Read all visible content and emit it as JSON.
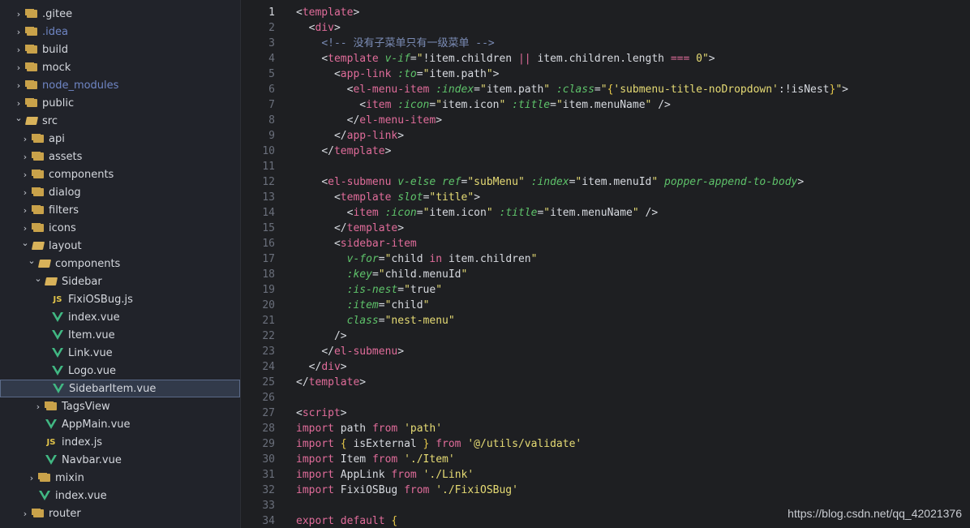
{
  "explorer": {
    "items": [
      {
        "label": ".gitee",
        "type": "folder",
        "expanded": false,
        "depth": 0
      },
      {
        "label": ".idea",
        "type": "folder",
        "expanded": false,
        "depth": 0,
        "dim": true
      },
      {
        "label": "build",
        "type": "folder",
        "expanded": false,
        "depth": 0
      },
      {
        "label": "mock",
        "type": "folder",
        "expanded": false,
        "depth": 0
      },
      {
        "label": "node_modules",
        "type": "folder",
        "expanded": false,
        "depth": 0,
        "dim": true
      },
      {
        "label": "public",
        "type": "folder",
        "expanded": false,
        "depth": 0
      },
      {
        "label": "src",
        "type": "folder",
        "expanded": true,
        "depth": 0
      },
      {
        "label": "api",
        "type": "folder",
        "expanded": false,
        "depth": 1
      },
      {
        "label": "assets",
        "type": "folder",
        "expanded": false,
        "depth": 1
      },
      {
        "label": "components",
        "type": "folder",
        "expanded": false,
        "depth": 1
      },
      {
        "label": "dialog",
        "type": "folder",
        "expanded": false,
        "depth": 1
      },
      {
        "label": "filters",
        "type": "folder",
        "expanded": false,
        "depth": 1
      },
      {
        "label": "icons",
        "type": "folder",
        "expanded": false,
        "depth": 1
      },
      {
        "label": "layout",
        "type": "folder",
        "expanded": true,
        "depth": 1
      },
      {
        "label": "components",
        "type": "folder",
        "expanded": true,
        "depth": 2
      },
      {
        "label": "Sidebar",
        "type": "folder",
        "expanded": true,
        "depth": 3
      },
      {
        "label": "FixiOSBug.js",
        "type": "js",
        "depth": 4
      },
      {
        "label": "index.vue",
        "type": "vue",
        "depth": 4
      },
      {
        "label": "Item.vue",
        "type": "vue",
        "depth": 4
      },
      {
        "label": "Link.vue",
        "type": "vue",
        "depth": 4
      },
      {
        "label": "Logo.vue",
        "type": "vue",
        "depth": 4
      },
      {
        "label": "SidebarItem.vue",
        "type": "vue",
        "depth": 4,
        "selected": true
      },
      {
        "label": "TagsView",
        "type": "folder",
        "expanded": false,
        "depth": 3
      },
      {
        "label": "AppMain.vue",
        "type": "vue",
        "depth": 3
      },
      {
        "label": "index.js",
        "type": "js",
        "depth": 3
      },
      {
        "label": "Navbar.vue",
        "type": "vue",
        "depth": 3
      },
      {
        "label": "mixin",
        "type": "folder",
        "expanded": false,
        "depth": 2
      },
      {
        "label": "index.vue",
        "type": "vue",
        "depth": 2
      },
      {
        "label": "router",
        "type": "folder",
        "expanded": false,
        "depth": 1
      }
    ]
  },
  "editor": {
    "active_line": 1,
    "lines": [
      [
        [
          "t-bracket",
          "<"
        ],
        [
          "t-tag",
          "template"
        ],
        [
          "t-bracket",
          ">"
        ]
      ],
      [
        [
          "t-plain",
          "  "
        ],
        [
          "t-bracket",
          "<"
        ],
        [
          "t-tag",
          "div"
        ],
        [
          "t-bracket",
          ">"
        ]
      ],
      [
        [
          "t-plain",
          "    "
        ],
        [
          "t-comment",
          "<!-- 没有子菜单只有一级菜单 -->"
        ]
      ],
      [
        [
          "t-plain",
          "    "
        ],
        [
          "t-bracket",
          "<"
        ],
        [
          "t-tag",
          "template "
        ],
        [
          "t-attr",
          "v-if"
        ],
        [
          "t-plain",
          "="
        ],
        [
          "t-str",
          "\""
        ],
        [
          "t-plain",
          "!item.children "
        ],
        [
          "t-kw",
          "||"
        ],
        [
          "t-plain",
          " item.children.length "
        ],
        [
          "t-kw",
          "==="
        ],
        [
          "t-plain",
          " "
        ],
        [
          "t-str",
          "0\""
        ],
        [
          "t-bracket",
          ">"
        ]
      ],
      [
        [
          "t-plain",
          "      "
        ],
        [
          "t-bracket",
          "<"
        ],
        [
          "t-tag",
          "app-link "
        ],
        [
          "t-attr",
          ":to"
        ],
        [
          "t-plain",
          "="
        ],
        [
          "t-str",
          "\""
        ],
        [
          "t-plain",
          "item.path"
        ],
        [
          "t-str",
          "\""
        ],
        [
          "t-bracket",
          ">"
        ]
      ],
      [
        [
          "t-plain",
          "        "
        ],
        [
          "t-bracket",
          "<"
        ],
        [
          "t-tag",
          "el-menu-item "
        ],
        [
          "t-attr",
          ":index"
        ],
        [
          "t-plain",
          "="
        ],
        [
          "t-str",
          "\""
        ],
        [
          "t-plain",
          "item.path"
        ],
        [
          "t-str",
          "\" "
        ],
        [
          "t-attr",
          ":class"
        ],
        [
          "t-plain",
          "="
        ],
        [
          "t-str",
          "\""
        ],
        [
          "t-brace",
          "{"
        ],
        [
          "t-str",
          "'submenu-title-noDropdown'"
        ],
        [
          "t-plain",
          ":!isNest"
        ],
        [
          "t-brace",
          "}"
        ],
        [
          "t-str",
          "\""
        ],
        [
          "t-bracket",
          ">"
        ]
      ],
      [
        [
          "t-plain",
          "          "
        ],
        [
          "t-bracket",
          "<"
        ],
        [
          "t-tag",
          "item "
        ],
        [
          "t-attr",
          ":icon"
        ],
        [
          "t-plain",
          "="
        ],
        [
          "t-str",
          "\""
        ],
        [
          "t-plain",
          "item.icon"
        ],
        [
          "t-str",
          "\" "
        ],
        [
          "t-attr",
          ":title"
        ],
        [
          "t-plain",
          "="
        ],
        [
          "t-str",
          "\""
        ],
        [
          "t-plain",
          "item.menuName"
        ],
        [
          "t-str",
          "\""
        ],
        [
          "t-plain",
          " "
        ],
        [
          "t-bracket",
          "/>"
        ]
      ],
      [
        [
          "t-plain",
          "        "
        ],
        [
          "t-bracket",
          "</"
        ],
        [
          "t-tag",
          "el-menu-item"
        ],
        [
          "t-bracket",
          ">"
        ]
      ],
      [
        [
          "t-plain",
          "      "
        ],
        [
          "t-bracket",
          "</"
        ],
        [
          "t-tag",
          "app-link"
        ],
        [
          "t-bracket",
          ">"
        ]
      ],
      [
        [
          "t-plain",
          "    "
        ],
        [
          "t-bracket",
          "</"
        ],
        [
          "t-tag",
          "template"
        ],
        [
          "t-bracket",
          ">"
        ]
      ],
      [],
      [
        [
          "t-plain",
          "    "
        ],
        [
          "t-bracket",
          "<"
        ],
        [
          "t-tag",
          "el-submenu "
        ],
        [
          "t-attr",
          "v-else ref"
        ],
        [
          "t-plain",
          "="
        ],
        [
          "t-str",
          "\"subMenu\" "
        ],
        [
          "t-attr",
          ":index"
        ],
        [
          "t-plain",
          "="
        ],
        [
          "t-str",
          "\""
        ],
        [
          "t-plain",
          "item.menuId"
        ],
        [
          "t-str",
          "\" "
        ],
        [
          "t-attr",
          "popper-append-to-body"
        ],
        [
          "t-bracket",
          ">"
        ]
      ],
      [
        [
          "t-plain",
          "      "
        ],
        [
          "t-bracket",
          "<"
        ],
        [
          "t-tag",
          "template "
        ],
        [
          "t-attr",
          "slot"
        ],
        [
          "t-plain",
          "="
        ],
        [
          "t-str",
          "\"title\""
        ],
        [
          "t-bracket",
          ">"
        ]
      ],
      [
        [
          "t-plain",
          "        "
        ],
        [
          "t-bracket",
          "<"
        ],
        [
          "t-tag",
          "item "
        ],
        [
          "t-attr",
          ":icon"
        ],
        [
          "t-plain",
          "="
        ],
        [
          "t-str",
          "\""
        ],
        [
          "t-plain",
          "item.icon"
        ],
        [
          "t-str",
          "\" "
        ],
        [
          "t-attr",
          ":title"
        ],
        [
          "t-plain",
          "="
        ],
        [
          "t-str",
          "\""
        ],
        [
          "t-plain",
          "item.menuName"
        ],
        [
          "t-str",
          "\""
        ],
        [
          "t-plain",
          " "
        ],
        [
          "t-bracket",
          "/>"
        ]
      ],
      [
        [
          "t-plain",
          "      "
        ],
        [
          "t-bracket",
          "</"
        ],
        [
          "t-tag",
          "template"
        ],
        [
          "t-bracket",
          ">"
        ]
      ],
      [
        [
          "t-plain",
          "      "
        ],
        [
          "t-bracket",
          "<"
        ],
        [
          "t-tag",
          "sidebar-item"
        ]
      ],
      [
        [
          "t-plain",
          "        "
        ],
        [
          "t-attr",
          "v-for"
        ],
        [
          "t-plain",
          "="
        ],
        [
          "t-str",
          "\""
        ],
        [
          "t-plain",
          "child "
        ],
        [
          "t-kw",
          "in"
        ],
        [
          "t-plain",
          " item.children"
        ],
        [
          "t-str",
          "\""
        ]
      ],
      [
        [
          "t-plain",
          "        "
        ],
        [
          "t-attr",
          ":key"
        ],
        [
          "t-plain",
          "="
        ],
        [
          "t-str",
          "\""
        ],
        [
          "t-plain",
          "child.menuId"
        ],
        [
          "t-str",
          "\""
        ]
      ],
      [
        [
          "t-plain",
          "        "
        ],
        [
          "t-attr",
          ":is-nest"
        ],
        [
          "t-plain",
          "="
        ],
        [
          "t-str",
          "\""
        ],
        [
          "t-plain",
          "true"
        ],
        [
          "t-str",
          "\""
        ]
      ],
      [
        [
          "t-plain",
          "        "
        ],
        [
          "t-attr",
          ":item"
        ],
        [
          "t-plain",
          "="
        ],
        [
          "t-str",
          "\""
        ],
        [
          "t-plain",
          "child"
        ],
        [
          "t-str",
          "\""
        ]
      ],
      [
        [
          "t-plain",
          "        "
        ],
        [
          "t-attr",
          "class"
        ],
        [
          "t-plain",
          "="
        ],
        [
          "t-str",
          "\"nest-menu\""
        ]
      ],
      [
        [
          "t-plain",
          "      "
        ],
        [
          "t-bracket",
          "/>"
        ]
      ],
      [
        [
          "t-plain",
          "    "
        ],
        [
          "t-bracket",
          "</"
        ],
        [
          "t-tag",
          "el-submenu"
        ],
        [
          "t-bracket",
          ">"
        ]
      ],
      [
        [
          "t-plain",
          "  "
        ],
        [
          "t-bracket",
          "</"
        ],
        [
          "t-tag",
          "div"
        ],
        [
          "t-bracket",
          ">"
        ]
      ],
      [
        [
          "t-bracket",
          "</"
        ],
        [
          "t-tag",
          "template"
        ],
        [
          "t-bracket",
          ">"
        ]
      ],
      [],
      [
        [
          "t-bracket",
          "<"
        ],
        [
          "t-tag",
          "script"
        ],
        [
          "t-bracket",
          ">"
        ]
      ],
      [
        [
          "t-kw",
          "import"
        ],
        [
          "t-plain",
          " path "
        ],
        [
          "t-kw",
          "from"
        ],
        [
          "t-plain",
          " "
        ],
        [
          "t-str",
          "'path'"
        ]
      ],
      [
        [
          "t-kw",
          "import"
        ],
        [
          "t-plain",
          " "
        ],
        [
          "t-brace",
          "{"
        ],
        [
          "t-plain",
          " isExternal "
        ],
        [
          "t-brace",
          "}"
        ],
        [
          "t-plain",
          " "
        ],
        [
          "t-kw",
          "from"
        ],
        [
          "t-plain",
          " "
        ],
        [
          "t-str",
          "'@/utils/validate'"
        ]
      ],
      [
        [
          "t-kw",
          "import"
        ],
        [
          "t-plain",
          " Item "
        ],
        [
          "t-kw",
          "from"
        ],
        [
          "t-plain",
          " "
        ],
        [
          "t-str",
          "'./Item'"
        ]
      ],
      [
        [
          "t-kw",
          "import"
        ],
        [
          "t-plain",
          " AppLink "
        ],
        [
          "t-kw",
          "from"
        ],
        [
          "t-plain",
          " "
        ],
        [
          "t-str",
          "'./Link'"
        ]
      ],
      [
        [
          "t-kw",
          "import"
        ],
        [
          "t-plain",
          " FixiOSBug "
        ],
        [
          "t-kw",
          "from"
        ],
        [
          "t-plain",
          " "
        ],
        [
          "t-str",
          "'./FixiOSBug'"
        ]
      ],
      [],
      [
        [
          "t-kw",
          "export default"
        ],
        [
          "t-plain",
          " "
        ],
        [
          "t-brace",
          "{"
        ]
      ]
    ]
  },
  "watermark": "https://blog.csdn.net/qq_42021376",
  "colors": {
    "sidebar_bg": "#21232a",
    "editor_bg": "#1e1f22",
    "selection": "#323a4a",
    "vue_green": "#41b883",
    "folder": "#c9a24a"
  }
}
